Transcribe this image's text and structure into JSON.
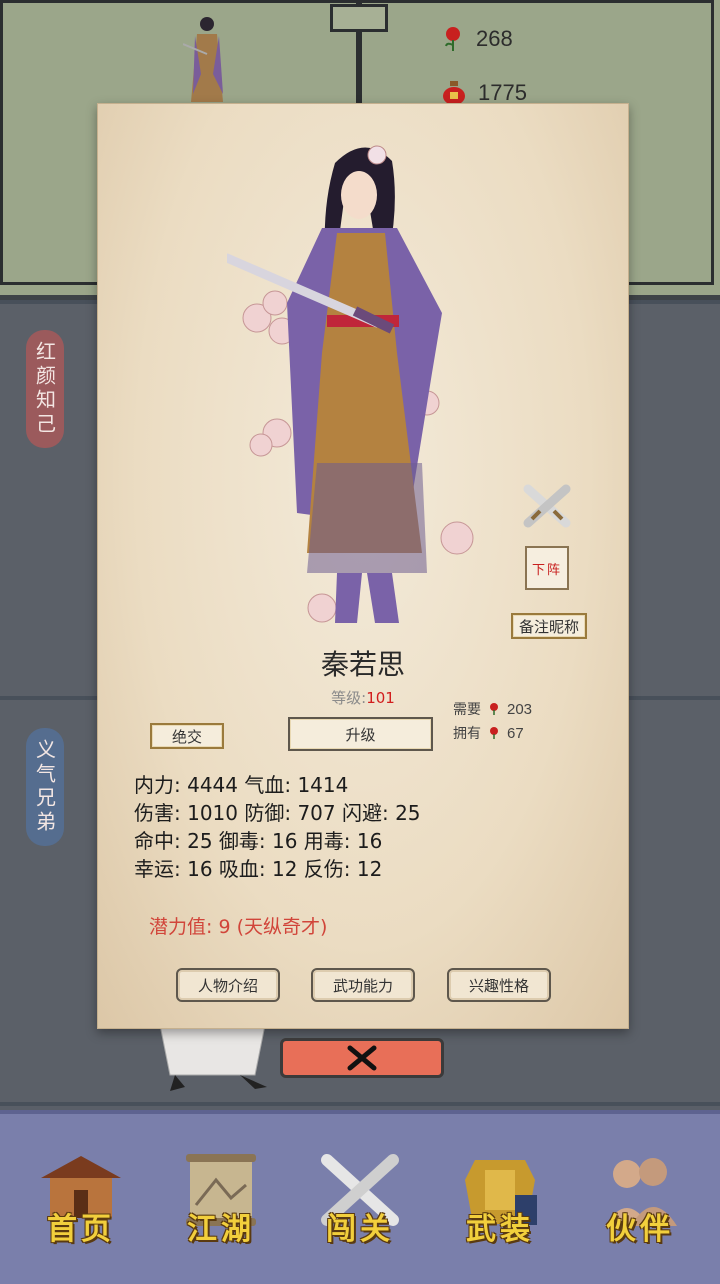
{
  "resources": [
    {
      "icon": "rose-icon",
      "value": "268"
    },
    {
      "icon": "wine-jar-icon",
      "value": "1775"
    }
  ],
  "side_tabs": {
    "confidants": "红颜知己",
    "sworn_brothers": "义气兄弟"
  },
  "character": {
    "name": "秦若思",
    "level_label": "等级:",
    "level_value": "101"
  },
  "actions": {
    "break_off": "绝交",
    "upgrade": "升级",
    "remark_nickname": "备注昵称",
    "dismiss": "下阵"
  },
  "upgrade_cost": {
    "need_label": "需要",
    "need_value": "203",
    "have_label": "拥有",
    "have_value": "67"
  },
  "stats": {
    "line1": "内力: 4444 气血: 1414",
    "line2": "伤害: 1010 防御: 707 闪避: 25",
    "line3": "命中: 25 御毒: 16 用毒: 16",
    "line4": "幸运: 16 吸血: 12 反伤: 12"
  },
  "potential": "潜力值:  9 (天纵奇才)",
  "tabs": {
    "profile": "人物介绍",
    "martial": "武功能力",
    "personality": "兴趣性格"
  },
  "nav": [
    {
      "label": "首页",
      "icon": "house-icon"
    },
    {
      "label": "江湖",
      "icon": "scroll-map-icon"
    },
    {
      "label": "闯关",
      "icon": "crossed-swords-icon"
    },
    {
      "label": "武装",
      "icon": "armor-icon"
    },
    {
      "label": "伙伴",
      "icon": "partners-icon"
    }
  ],
  "colors": {
    "accent_red": "#d21d1d",
    "close_button": "#e86f58",
    "nav_bg": "#7a7fab",
    "nav_label": "#f2cf3c"
  }
}
